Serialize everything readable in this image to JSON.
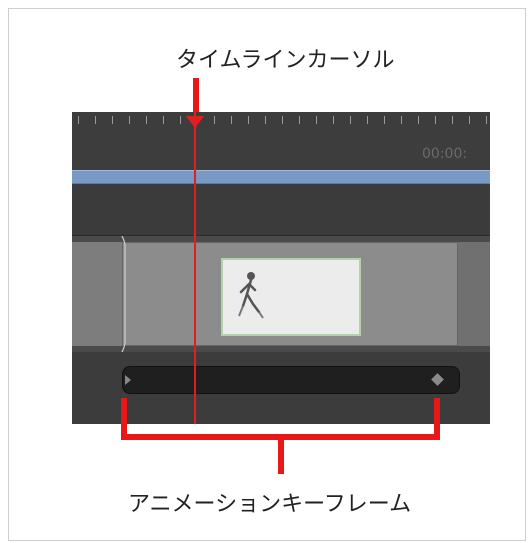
{
  "labels": {
    "timeline_cursor": "タイムラインカーソル",
    "animation_keyframe": "アニメーションキーフレーム"
  },
  "timeline": {
    "timecode": "00:00:"
  },
  "colors": {
    "annotation_red": "#e81818",
    "cursor_red": "#e02020",
    "track_blue": "#7a9ac6"
  },
  "icons": {
    "cursor_head": "triangle-down",
    "keyframe": "diamond",
    "clip_start": "triangle-right"
  }
}
